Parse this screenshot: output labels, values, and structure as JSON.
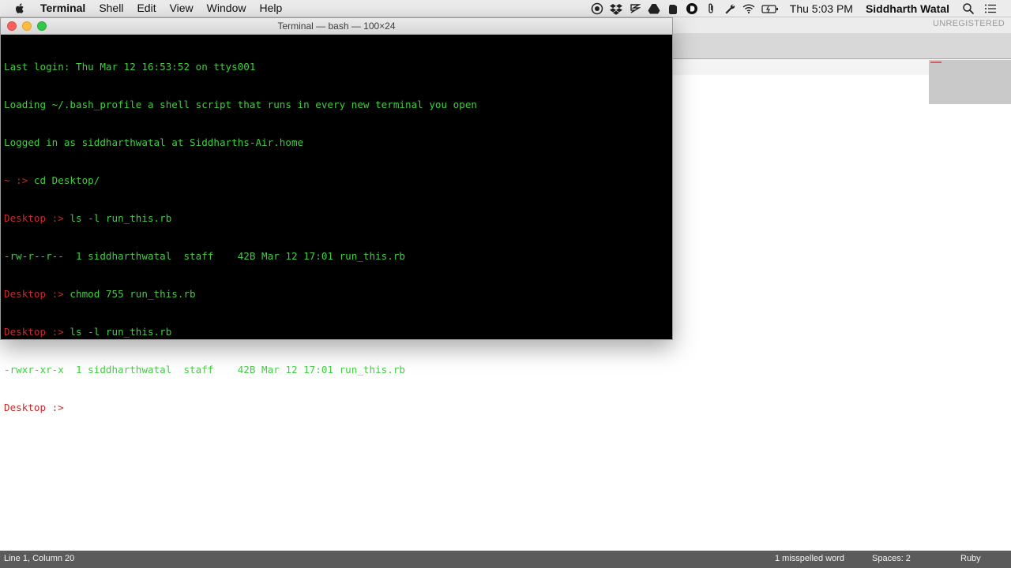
{
  "menubar": {
    "app_name": "Terminal",
    "items": [
      "Shell",
      "Edit",
      "View",
      "Window",
      "Help"
    ],
    "clock": "Thu 5:03 PM",
    "user": "Siddharth Watal",
    "status_icons": [
      "record-icon",
      "dropbox-icon",
      "evernote-icon",
      "google-drive-icon",
      "evernote-elephant-icon",
      "d-icon",
      "paperclip-icon",
      "wrench-icon",
      "wifi-icon",
      "battery-icon"
    ]
  },
  "terminal": {
    "title": "Terminal — bash — 100×24",
    "lines": [
      {
        "prompt": "",
        "text": "Last login: Thu Mar 12 16:53:52 on ttys001"
      },
      {
        "prompt": "",
        "text": "Loading ~/.bash_profile a shell script that runs in every new terminal you open"
      },
      {
        "prompt": "",
        "text": "Logged in as siddharthwatal at Siddharths-Air.home"
      },
      {
        "prompt": "~ :> ",
        "text": "cd Desktop/"
      },
      {
        "prompt": "Desktop :> ",
        "text": "ls -l run_this.rb"
      },
      {
        "prompt": "",
        "text": "-rw-r--r--  1 siddharthwatal  staff    42B Mar 12 17:01 run_this.rb"
      },
      {
        "prompt": "Desktop :> ",
        "text": "chmod 755 run_this.rb"
      },
      {
        "prompt": "Desktop :> ",
        "text": "ls -l run_this.rb"
      },
      {
        "prompt": "",
        "text": "-rwxr-xr-x  1 siddharthwatal  staff    42B Mar 12 17:01 run_this.rb"
      },
      {
        "prompt": "Desktop :> ",
        "text": ""
      }
    ]
  },
  "editor": {
    "unregistered": "UNREGISTERED",
    "status_left": "Line 1, Column 20",
    "misspelled": "1 misspelled word",
    "spaces": "Spaces: 2",
    "language": "Ruby"
  }
}
